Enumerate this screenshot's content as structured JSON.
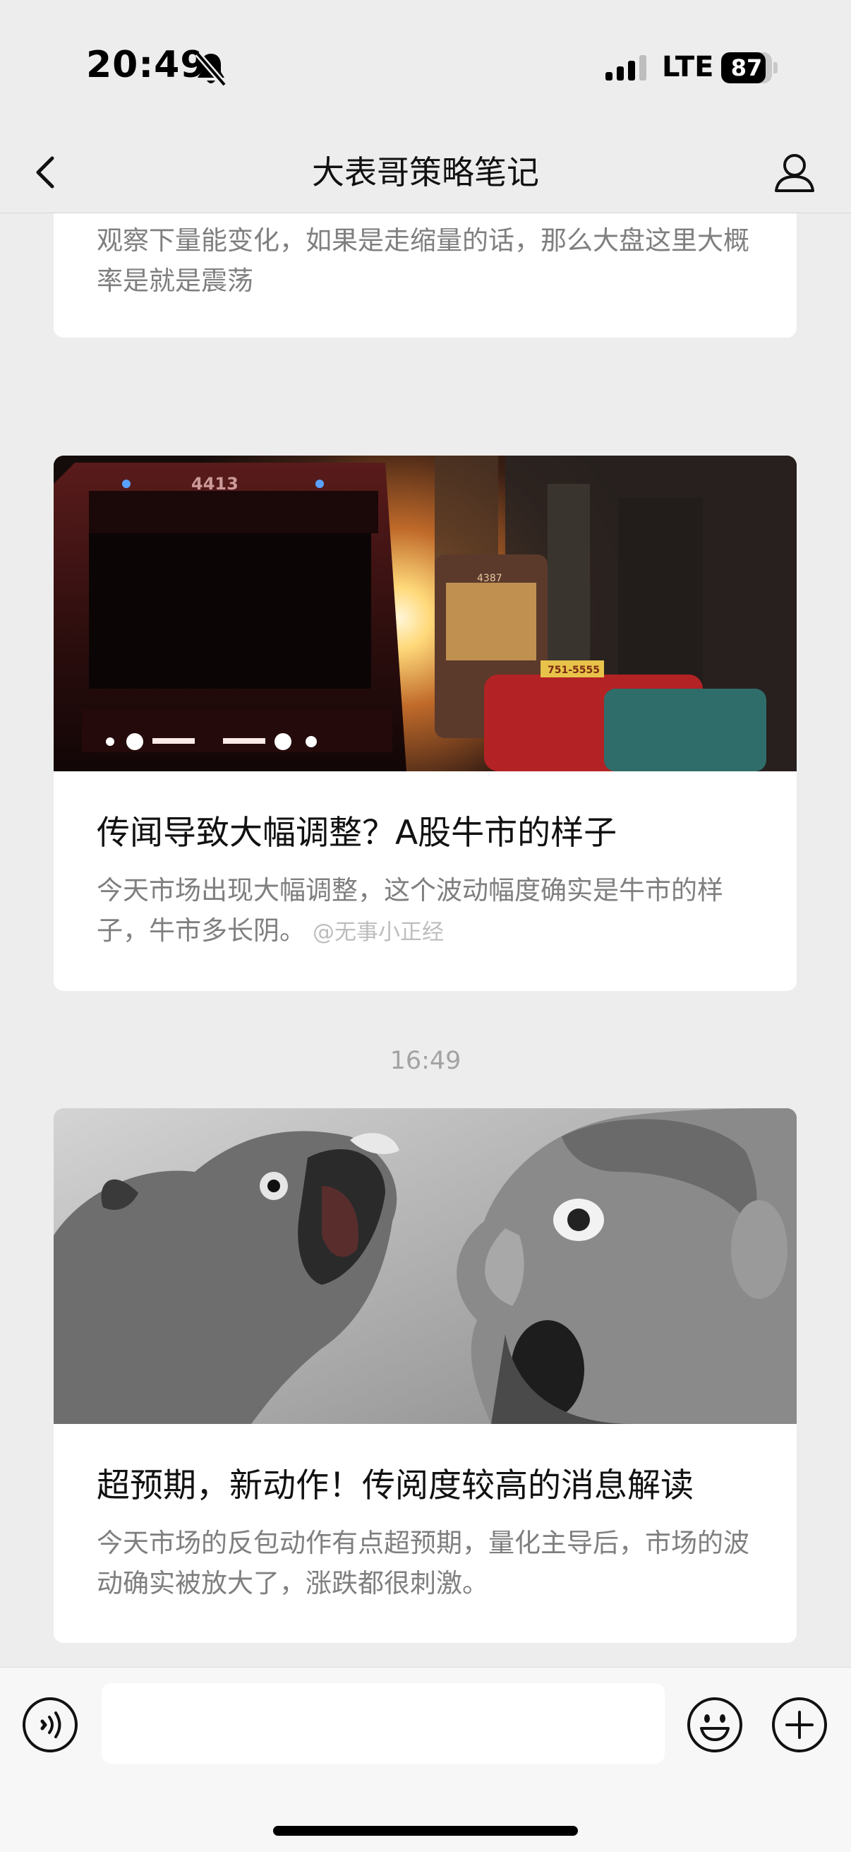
{
  "status_bar": {
    "time": "20:49",
    "network": "LTE",
    "battery": "87",
    "battery_level": 0.87,
    "icons": [
      "bell-slash-icon",
      "signal-icon",
      "battery-icon"
    ]
  },
  "nav": {
    "title": "大表哥策略笔记",
    "icons": [
      "back-chevron-icon",
      "profile-icon"
    ]
  },
  "messages": {
    "partial_card": {
      "desc": "观察下量能变化，如果是走缩量的话，那么大盘这里大概率是就是震荡"
    },
    "card1": {
      "image": "tram-sunset-street-photo",
      "image_text": {
        "tram_number": "4413",
        "tram2_number": "4387",
        "taxi_plate": "751-5555"
      },
      "title": "传闻导致大幅调整？A股牛市的样子",
      "desc": "今天市场出现大幅调整，这个波动幅度确实是牛市的样子，牛市多长阴。",
      "watermark": "@无事小正经"
    },
    "timestamp": "16:49",
    "card2": {
      "image": "screaming-bull-and-man-illustration",
      "title": "超预期，新动作！传阅度较高的消息解读",
      "desc": "今天市场的反包动作有点超预期，量化主导后，市场的波动确实被放大了，涨跌都很刺激。"
    }
  },
  "input_bar": {
    "placeholder": "",
    "icons": [
      "voice-icon",
      "emoji-icon",
      "plus-icon"
    ]
  },
  "colors": {
    "background": "#ededed",
    "card": "#ffffff",
    "title_text": "#111111",
    "desc_text": "#7f7f7f",
    "timestamp_text": "#a3a3a3"
  }
}
